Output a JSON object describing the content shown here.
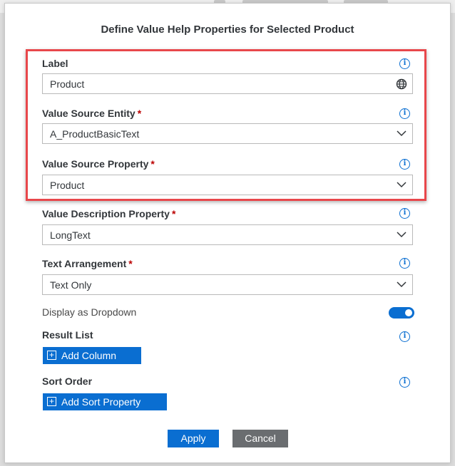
{
  "dialog": {
    "title": "Define Value Help Properties for Selected Product"
  },
  "fields": {
    "label": {
      "label": "Label",
      "value": "Product",
      "icon": "globe-icon"
    },
    "value_source_entity": {
      "label": "Value Source Entity",
      "required": "*",
      "value": "A_ProductBasicText"
    },
    "value_source_property": {
      "label": "Value Source Property",
      "required": "*",
      "value": "Product"
    },
    "value_description_property": {
      "label": "Value Description Property",
      "required": "*",
      "value": "LongText"
    },
    "text_arrangement": {
      "label": "Text Arrangement",
      "required": "*",
      "value": "Text Only"
    }
  },
  "display_dropdown": {
    "label": "Display as Dropdown",
    "enabled": true
  },
  "result_list": {
    "label": "Result List",
    "button": "Add Column"
  },
  "sort_order": {
    "label": "Sort Order",
    "button": "Add Sort Property"
  },
  "footer": {
    "apply": "Apply",
    "cancel": "Cancel"
  },
  "colors": {
    "accent": "#0a6ed1",
    "required": "#bb0000",
    "highlight": "#e8474b",
    "cancel_button": "#6a6d70"
  },
  "icons": {
    "info": "info-icon",
    "dropdown": "chevron-down-icon",
    "add": "plus-square-icon"
  }
}
